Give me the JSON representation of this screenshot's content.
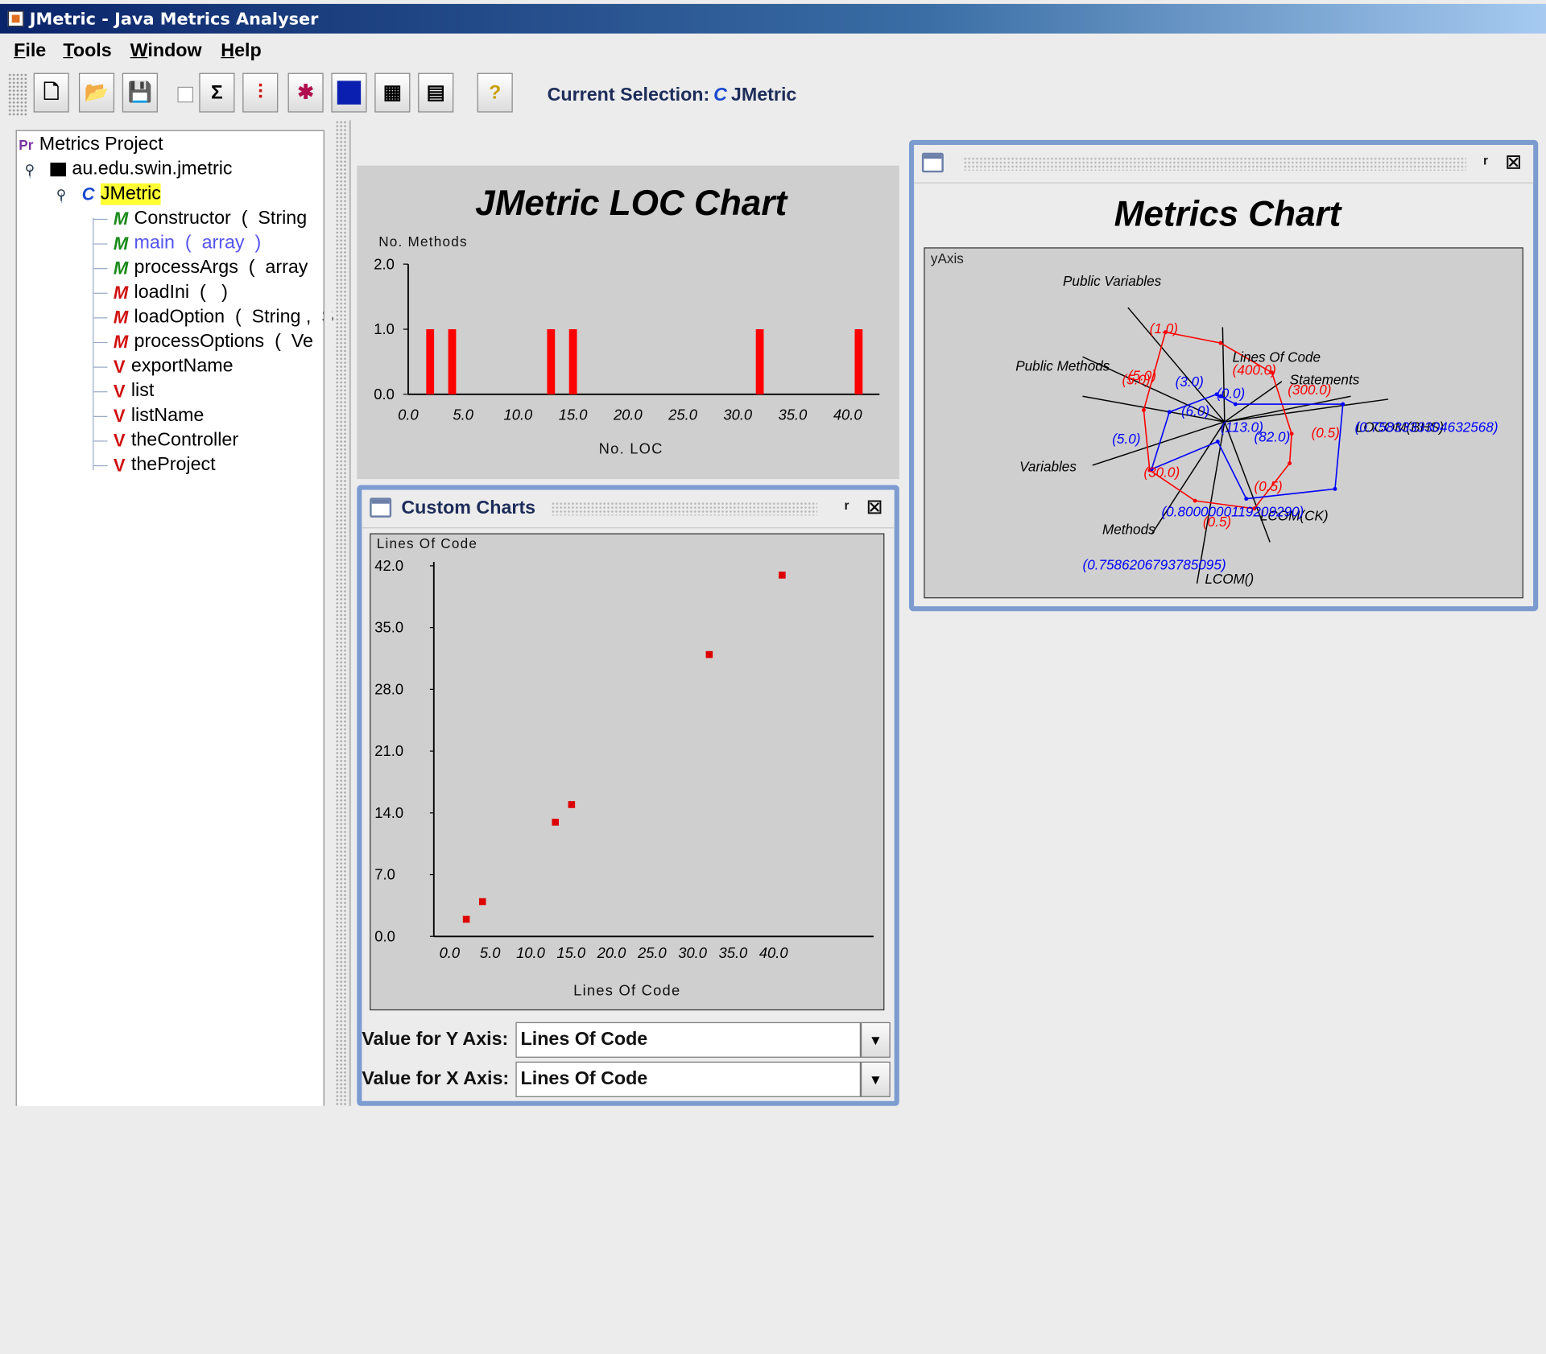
{
  "window": {
    "title": "JMetric - Java Metrics Analyser"
  },
  "menu": [
    {
      "label": "File"
    },
    {
      "label": "Tools"
    },
    {
      "label": "Window"
    },
    {
      "label": "Help"
    }
  ],
  "toolbar": {
    "buttons": [
      {
        "name": "new-file-icon",
        "glyph": "🗋"
      },
      {
        "name": "open-folder-icon",
        "glyph": "📂"
      },
      {
        "name": "save-disk-icon",
        "glyph": "💾"
      },
      {
        "name": "sum-icon",
        "glyph": "Σ"
      },
      {
        "name": "bar-chart-icon",
        "glyph": "⫶"
      },
      {
        "name": "radar-chart-icon",
        "glyph": "✱"
      },
      {
        "name": "color-fill-icon",
        "glyph": ""
      },
      {
        "name": "table-icon",
        "glyph": "▦"
      },
      {
        "name": "table-alt-icon",
        "glyph": "▤"
      },
      {
        "name": "help-icon",
        "glyph": "?"
      }
    ],
    "current_selection_label": "Current Selection:",
    "current_selection_icon": "C",
    "current_selection_value": "JMetric"
  },
  "tree": {
    "root": {
      "icon": "Pr",
      "label": "Metrics Project"
    },
    "package": {
      "label": "au.edu.swin.jmetric"
    },
    "class": {
      "icon": "C",
      "label": "JMetric"
    },
    "members": [
      {
        "icon": "M",
        "kind": "method-public",
        "label": "Constructor  (  String"
      },
      {
        "icon": "M",
        "kind": "method-public",
        "label": "main  (  array  )"
      },
      {
        "icon": "M",
        "kind": "method-public",
        "label": "processArgs  (  array"
      },
      {
        "icon": "M",
        "kind": "method-private",
        "label": "loadIni  (   )"
      },
      {
        "icon": "M",
        "kind": "method-private",
        "label": "loadOption  (  String ,  S"
      },
      {
        "icon": "M",
        "kind": "method-private",
        "label": "processOptions  (  Ve"
      },
      {
        "icon": "V",
        "kind": "variable",
        "label": "exportName"
      },
      {
        "icon": "V",
        "kind": "variable",
        "label": "list"
      },
      {
        "icon": "V",
        "kind": "variable",
        "label": "listName"
      },
      {
        "icon": "V",
        "kind": "variable",
        "label": "theController"
      },
      {
        "icon": "V",
        "kind": "variable",
        "label": "theProject"
      }
    ]
  },
  "custom_charts": {
    "title": "Custom Charts",
    "y_axis_label": "Value for Y Axis:",
    "y_axis_value": "Lines Of Code",
    "x_axis_label": "Value for X Axis:",
    "x_axis_value": "Lines Of Code"
  },
  "metrics_window": {
    "title": "Metrics Chart"
  },
  "chart_data": [
    {
      "type": "bar",
      "title": "JMetric LOC Chart",
      "xlabel": "No. LOC",
      "ylabel": "No. Methods",
      "xlim": [
        0,
        42
      ],
      "ylim": [
        0,
        2
      ],
      "x_ticks": [
        "0.0",
        "5.0",
        "10.0",
        "15.0",
        "20.0",
        "25.0",
        "30.0",
        "35.0",
        "40.0"
      ],
      "y_ticks": [
        "0.0",
        "1.0",
        "2.0"
      ],
      "x": [
        2,
        4,
        13,
        15,
        32,
        41
      ],
      "values": [
        1,
        1,
        1,
        1,
        1,
        1
      ],
      "color": "#ff0000"
    },
    {
      "type": "scatter",
      "xlabel": "Lines Of Code",
      "ylabel": "Lines Of Code",
      "xlim": [
        0,
        42
      ],
      "ylim": [
        0,
        42
      ],
      "x_ticks": [
        "0.0",
        "5.0",
        "10.0",
        "15.0",
        "20.0",
        "25.0",
        "30.0",
        "35.0",
        "40.0"
      ],
      "y_ticks": [
        "0.0",
        "7.0",
        "14.0",
        "21.0",
        "28.0",
        "35.0",
        "42.0"
      ],
      "points": [
        [
          2,
          2
        ],
        [
          4,
          4
        ],
        [
          13,
          13
        ],
        [
          15,
          15
        ],
        [
          32,
          32
        ],
        [
          41,
          41
        ]
      ],
      "color": "#dd0000"
    },
    {
      "type": "radar",
      "title": "Metrics Chart",
      "ylabel": "yAxis",
      "axes": [
        {
          "name": "Public Variables"
        },
        {
          "name": "Lines Of Code"
        },
        {
          "name": "Statements"
        },
        {
          "name": "LOCOM(BHS)"
        },
        {
          "name": "LCOM(CK)"
        },
        {
          "name": "LCOM()"
        },
        {
          "name": "Methods"
        },
        {
          "name": "Variables"
        },
        {
          "name": "Public Methods"
        }
      ],
      "series": [
        {
          "color": "#ff0000",
          "labels": [
            "(1.0)",
            "(400.0)",
            "(300.0)",
            "(0.5)",
            "(0.5)",
            "(0.5)",
            "(30.0)",
            "(5.0)",
            "(5.0)"
          ]
        },
        {
          "color": "#0000ff",
          "labels": [
            "(0.0)",
            "(113.0)",
            "(82.0)",
            "(0.7583333304632568)",
            "(0.8000000119209290)",
            "(0.7586206793785095)",
            "(5.0)",
            "(6.0)",
            "(3.0)"
          ]
        }
      ]
    }
  ]
}
